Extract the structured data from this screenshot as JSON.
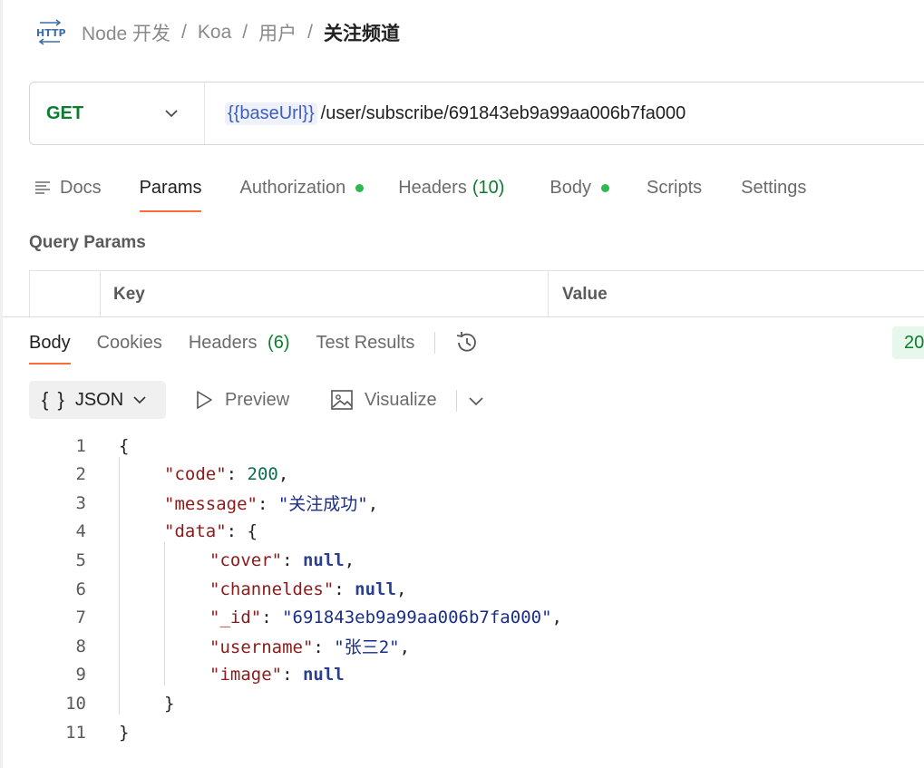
{
  "breadcrumb": {
    "icon": "http-icon",
    "items": [
      "Node 开发",
      "Koa",
      "用户"
    ],
    "current": "关注频道",
    "separator": "/"
  },
  "request": {
    "method": "GET",
    "url_variable": "{{baseUrl}}",
    "url_path": "/user/subscribe/691843eb9a99aa006b7fa000"
  },
  "request_tabs": {
    "docs": "Docs",
    "params": "Params",
    "authorization": "Authorization",
    "headers": "Headers",
    "headers_count": "(10)",
    "body": "Body",
    "scripts": "Scripts",
    "settings": "Settings",
    "active": "Params"
  },
  "query_params": {
    "title": "Query Params",
    "columns": [
      "Key",
      "Value"
    ]
  },
  "response_tabs": {
    "body": "Body",
    "cookies": "Cookies",
    "headers": "Headers",
    "headers_count": "(6)",
    "test_results": "Test Results",
    "active": "Body",
    "status_visible": "20"
  },
  "response_toolbar": {
    "format_braces": "{ }",
    "format": "JSON",
    "preview": "Preview",
    "visualize": "Visualize"
  },
  "code_lines": [
    {
      "n": "1",
      "parts": [
        [
          "p",
          "{"
        ]
      ],
      "indent": 0
    },
    {
      "n": "2",
      "parts": [
        [
          "k",
          "\"code\""
        ],
        [
          "p",
          ": "
        ],
        [
          "n",
          "200"
        ],
        [
          "p",
          ","
        ]
      ],
      "indent": 1
    },
    {
      "n": "3",
      "parts": [
        [
          "k",
          "\"message\""
        ],
        [
          "p",
          ": "
        ],
        [
          "s",
          "\"关注成功\""
        ],
        [
          "p",
          ","
        ]
      ],
      "indent": 1
    },
    {
      "n": "4",
      "parts": [
        [
          "k",
          "\"data\""
        ],
        [
          "p",
          ": {"
        ]
      ],
      "indent": 1
    },
    {
      "n": "5",
      "parts": [
        [
          "k",
          "\"cover\""
        ],
        [
          "p",
          ": "
        ],
        [
          "kw",
          "null"
        ],
        [
          "p",
          ","
        ]
      ],
      "indent": 2
    },
    {
      "n": "6",
      "parts": [
        [
          "k",
          "\"channeldes\""
        ],
        [
          "p",
          ": "
        ],
        [
          "kw",
          "null"
        ],
        [
          "p",
          ","
        ]
      ],
      "indent": 2
    },
    {
      "n": "7",
      "parts": [
        [
          "k",
          "\"_id\""
        ],
        [
          "p",
          ": "
        ],
        [
          "s",
          "\"691843eb9a99aa006b7fa000\""
        ],
        [
          "p",
          ","
        ]
      ],
      "indent": 2
    },
    {
      "n": "8",
      "parts": [
        [
          "k",
          "\"username\""
        ],
        [
          "p",
          ": "
        ],
        [
          "s",
          "\"张三2\""
        ],
        [
          "p",
          ","
        ]
      ],
      "indent": 2
    },
    {
      "n": "9",
      "parts": [
        [
          "k",
          "\"image\""
        ],
        [
          "p",
          ": "
        ],
        [
          "kw",
          "null"
        ]
      ],
      "indent": 2
    },
    {
      "n": "10",
      "parts": [
        [
          "p",
          "}"
        ]
      ],
      "indent": 1
    },
    {
      "n": "11",
      "parts": [
        [
          "p",
          "}"
        ]
      ],
      "indent": 0
    }
  ],
  "colors": {
    "accent": "#ff6c37",
    "method_get": "#0b7d2f",
    "status_dot": "#2fb84e",
    "json_key": "#8b1a1a",
    "json_string": "#1a2d8b",
    "json_number": "#0b6e4f"
  }
}
